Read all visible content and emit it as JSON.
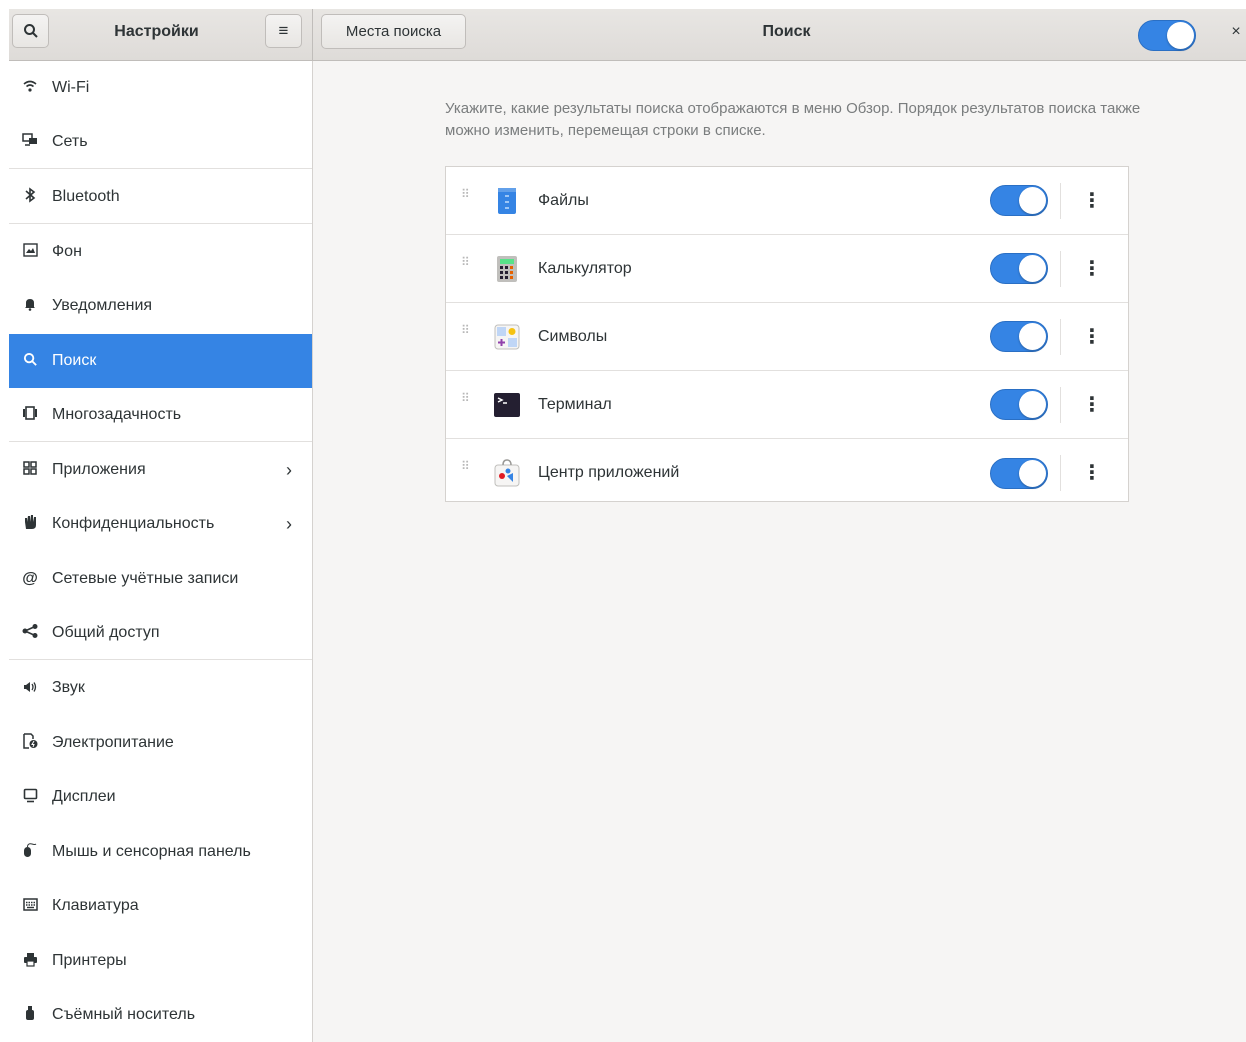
{
  "header": {
    "settings_title": "Настройки",
    "places_button": "Места поиска",
    "page_title": "Поиск",
    "close_glyph": "×",
    "search_toggle_on": true
  },
  "sidebar": {
    "items": [
      {
        "label": "Wi-Fi",
        "icon": "wifi-icon"
      },
      {
        "label": "Сеть",
        "icon": "network-icon"
      },
      {
        "label": "Bluetooth",
        "icon": "bluetooth-icon"
      },
      {
        "label": "Фон",
        "icon": "background-icon"
      },
      {
        "label": "Уведомления",
        "icon": "bell-icon"
      },
      {
        "label": "Поиск",
        "icon": "search-icon"
      },
      {
        "label": "Многозадачность",
        "icon": "multitasking-icon"
      },
      {
        "label": "Приложения",
        "icon": "apps-icon"
      },
      {
        "label": "Конфиденциальность",
        "icon": "hand-icon"
      },
      {
        "label": "Сетевые учётные записи",
        "icon": "at-icon"
      },
      {
        "label": "Общий доступ",
        "icon": "share-icon"
      },
      {
        "label": "Звук",
        "icon": "speaker-icon"
      },
      {
        "label": "Электропитание",
        "icon": "power-icon"
      },
      {
        "label": "Дисплеи",
        "icon": "display-icon"
      },
      {
        "label": "Мышь и сенсорная панель",
        "icon": "mouse-icon"
      },
      {
        "label": "Клавиатура",
        "icon": "keyboard-icon"
      },
      {
        "label": "Принтеры",
        "icon": "printer-icon"
      },
      {
        "label": "Съёмный носитель",
        "icon": "usb-icon"
      }
    ],
    "active": "Поиск"
  },
  "main": {
    "description": "Укажите, какие результаты поиска отображаются в меню Обзор. Порядок результатов поиска также можно изменить, перемещая строки в списке.",
    "providers": [
      {
        "name": "Файлы",
        "icon": "files-app-icon",
        "enabled": true
      },
      {
        "name": "Калькулятор",
        "icon": "calculator-app-icon",
        "enabled": true
      },
      {
        "name": "Символы",
        "icon": "characters-app-icon",
        "enabled": true
      },
      {
        "name": "Терминал",
        "icon": "terminal-app-icon",
        "enabled": true
      },
      {
        "name": "Центр приложений",
        "icon": "software-app-icon",
        "enabled": true
      }
    ]
  },
  "colors": {
    "accent": "#3584e4",
    "sidebar_bg": "#ffffff",
    "content_bg": "#f6f5f4"
  }
}
